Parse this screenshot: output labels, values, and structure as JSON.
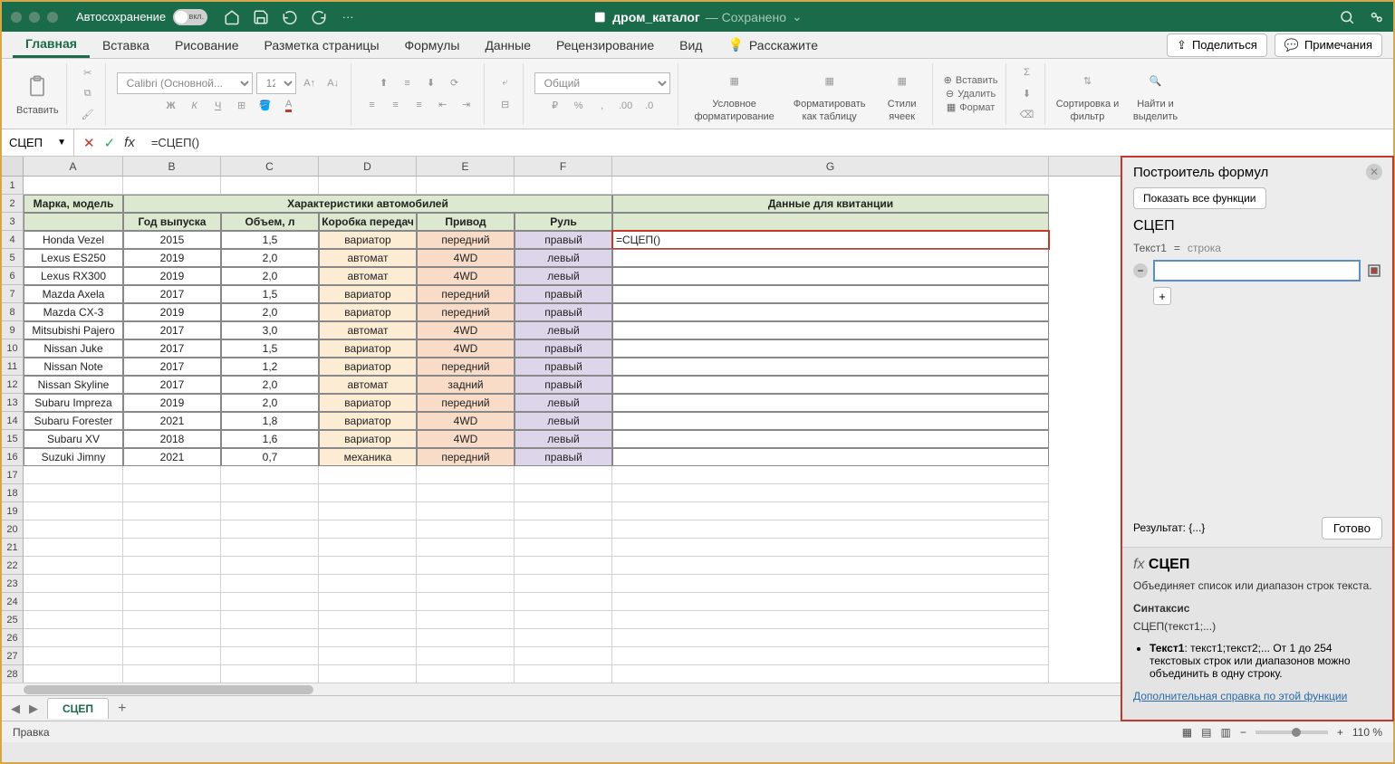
{
  "titlebar": {
    "autosave_label": "Автосохранение",
    "toggle_text": "вкл.",
    "doc_name": "дром_каталог",
    "saved_label": "— Сохранено"
  },
  "tabs": {
    "home": "Главная",
    "insert": "Вставка",
    "draw": "Рисование",
    "layout": "Разметка страницы",
    "formulas": "Формулы",
    "data": "Данные",
    "review": "Рецензирование",
    "view": "Вид",
    "tell": "Расскажите",
    "share": "Поделиться",
    "comments": "Примечания"
  },
  "ribbon": {
    "paste": "Вставить",
    "font_name": "Calibri (Основной...",
    "font_size": "12",
    "number_format": "Общий",
    "cond_fmt": "Условное форматирование",
    "fmt_table": "Форматировать как таблицу",
    "cell_styles": "Стили ячеек",
    "insert": "Вставить",
    "delete": "Удалить",
    "format": "Формат",
    "sort": "Сортировка и фильтр",
    "find": "Найти и выделить"
  },
  "formula_bar": {
    "name": "СЦЕП",
    "formula": "=СЦЕП()"
  },
  "columns": [
    "A",
    "B",
    "C",
    "D",
    "E",
    "F",
    "G"
  ],
  "table": {
    "h_model": "Марка, модель",
    "h_chars": "Характеристики автомобилей",
    "h_receipt": "Данные для квитанции",
    "h_year": "Год выпуска",
    "h_vol": "Объем, л",
    "h_gear": "Коробка передач",
    "h_drive": "Привод",
    "h_wheel": "Руль",
    "active_formula": "=СЦЕП()",
    "rows": [
      {
        "a": "Honda Vezel",
        "b": "2015",
        "c": "1,5",
        "d": "вариатор",
        "e": "передний",
        "f": "правый"
      },
      {
        "a": "Lexus ES250",
        "b": "2019",
        "c": "2,0",
        "d": "автомат",
        "e": "4WD",
        "f": "левый"
      },
      {
        "a": "Lexus RX300",
        "b": "2019",
        "c": "2,0",
        "d": "автомат",
        "e": "4WD",
        "f": "левый"
      },
      {
        "a": "Mazda Axela",
        "b": "2017",
        "c": "1,5",
        "d": "вариатор",
        "e": "передний",
        "f": "правый"
      },
      {
        "a": "Mazda CX-3",
        "b": "2019",
        "c": "2,0",
        "d": "вариатор",
        "e": "передний",
        "f": "правый"
      },
      {
        "a": "Mitsubishi Pajero",
        "b": "2017",
        "c": "3,0",
        "d": "автомат",
        "e": "4WD",
        "f": "левый"
      },
      {
        "a": "Nissan Juke",
        "b": "2017",
        "c": "1,5",
        "d": "вариатор",
        "e": "4WD",
        "f": "правый"
      },
      {
        "a": "Nissan Note",
        "b": "2017",
        "c": "1,2",
        "d": "вариатор",
        "e": "передний",
        "f": "правый"
      },
      {
        "a": "Nissan Skyline",
        "b": "2017",
        "c": "2,0",
        "d": "автомат",
        "e": "задний",
        "f": "правый"
      },
      {
        "a": "Subaru Impreza",
        "b": "2019",
        "c": "2,0",
        "d": "вариатор",
        "e": "передний",
        "f": "левый"
      },
      {
        "a": "Subaru Forester",
        "b": "2021",
        "c": "1,8",
        "d": "вариатор",
        "e": "4WD",
        "f": "левый"
      },
      {
        "a": "Subaru XV",
        "b": "2018",
        "c": "1,6",
        "d": "вариатор",
        "e": "4WD",
        "f": "левый"
      },
      {
        "a": "Suzuki Jimny",
        "b": "2021",
        "c": "0,7",
        "d": "механика",
        "e": "передний",
        "f": "правый"
      }
    ]
  },
  "sheet_tab": "СЦЕП",
  "status": {
    "mode": "Правка",
    "zoom": "110 %"
  },
  "panel": {
    "title": "Построитель формул",
    "show_all": "Показать все функции",
    "fn": "СЦЕП",
    "arg_label": "Текст1",
    "arg_eq": "=",
    "arg_hint": "строка",
    "result_label": "Результат:",
    "result_value": "{...}",
    "done": "Готово",
    "help_fn": "СЦЕП",
    "help_desc": "Объединяет список или диапазон строк текста.",
    "syntax_label": "Синтаксис",
    "syntax": "СЦЕП(текст1;...)",
    "arg_name": "Текст1",
    "arg_desc": ": текст1;текст2;... От 1 до 254 текстовых строк или диапазонов можно объединить в одну строку.",
    "more_help": "Дополнительная справка по этой функции"
  }
}
